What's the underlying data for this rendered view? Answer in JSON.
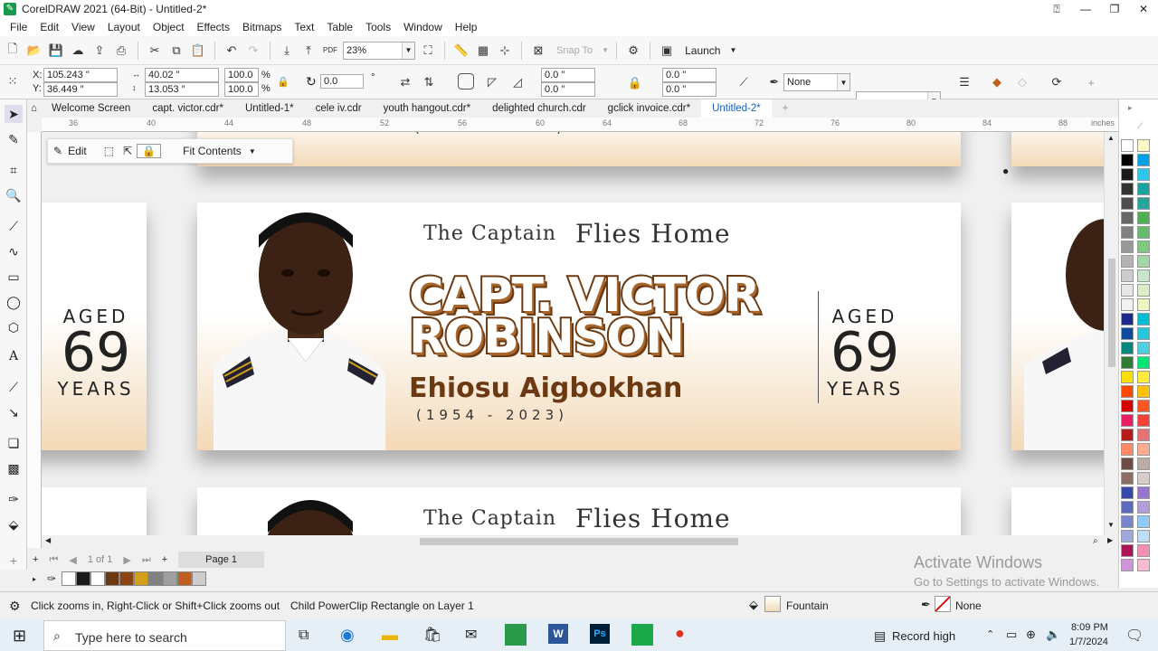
{
  "window": {
    "title": "CorelDRAW 2021 (64-Bit) - Untitled-2*"
  },
  "menu": [
    "File",
    "Edit",
    "View",
    "Layout",
    "Object",
    "Effects",
    "Bitmaps",
    "Text",
    "Table",
    "Tools",
    "Window",
    "Help"
  ],
  "toolbar": {
    "zoom": "23%",
    "snap_to": "Snap To",
    "launch": "Launch"
  },
  "propbar": {
    "x_label": "X:",
    "x": "105.243 \"",
    "y_label": "Y:",
    "y": "36.449 \"",
    "w": "40.02 \"",
    "h": "13.053 \"",
    "scale_w": "100.0",
    "scale_h": "100.0",
    "pct": "%",
    "rotation": "0.0",
    "corner1": "0.0 \"",
    "corner2": "0.0 \"",
    "corner3": "0.0 \"",
    "corner4": "0.0 \"",
    "outline": "None"
  },
  "doc_tabs": [
    "Welcome Screen",
    "capt. victor.cdr*",
    "Untitled-1*",
    "cele iv.cdr",
    "youth hangout.cdr*",
    "delighted church.cdr",
    "gclick invoice.cdr*",
    "Untitled-2*"
  ],
  "ruler_top": [
    "36",
    "40",
    "44",
    "48",
    "52",
    "56",
    "60",
    "64",
    "68",
    "72",
    "76",
    "80",
    "84",
    "88"
  ],
  "ruler_unit": "inches",
  "floatbar": {
    "edit": "Edit",
    "fit": "Fit Contents"
  },
  "banner": {
    "title_small": "The Captain",
    "title_big": "Flies Home",
    "name_line1": "CAPT. VICTOR",
    "name_line2": "ROBINSON",
    "subname": "Ehiosu Aigbokhan",
    "years": "(1954 - 2023)",
    "aged": "AGED",
    "age": "69",
    "years_word": "YEARS"
  },
  "pagebar": {
    "page_count": "1 of 1",
    "page_tab": "Page 1"
  },
  "status": {
    "hint": "Click zooms in, Right-Click or Shift+Click zooms out",
    "object": "Child PowerClip Rectangle on Layer 1",
    "fill": "Fountain",
    "outline": "None"
  },
  "watermark": {
    "line1": "Activate Windows",
    "line2": "Go to Settings to activate Windows."
  },
  "taskbar": {
    "search": "Type here to search",
    "record": "Record high",
    "time": "8:09 PM",
    "date": "1/7/2024"
  },
  "colors": {
    "accent": "#1a5fb4",
    "name_stroke": "#6b3a12",
    "banner_bottom": "#f3d9b6"
  }
}
